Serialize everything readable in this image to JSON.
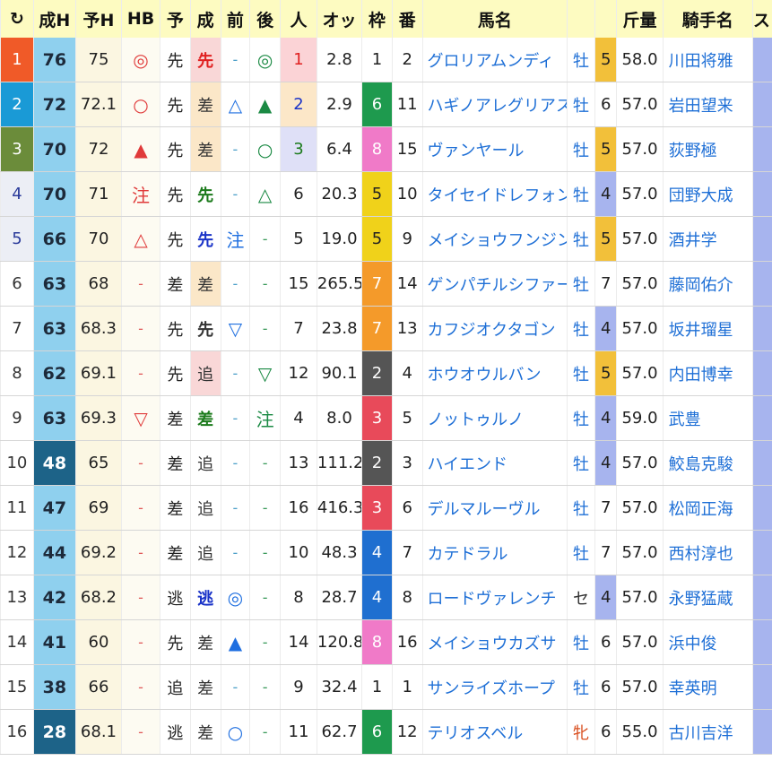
{
  "header": {
    "reload_icon": "↻",
    "columns": [
      "成H",
      "予H",
      "HB",
      "予",
      "成",
      "前",
      "後",
      "人",
      "オッ",
      "枠",
      "番",
      "馬名",
      "",
      "斤量",
      "騎手名",
      "ス"
    ]
  },
  "rows": [
    {
      "rank": "1",
      "seih": "76",
      "yoh": "75",
      "hb": "◎",
      "yo": "先",
      "sei": "先",
      "mae": "-",
      "ato": "◎",
      "ninki": "1",
      "odds": "2.8",
      "waku": "1",
      "ban": "2",
      "name": "グロリアムンディ",
      "sex": "牡",
      "age": "5",
      "kinryo": "58.0",
      "jockey": "川田将雅"
    },
    {
      "rank": "2",
      "seih": "72",
      "yoh": "72.1",
      "hb": "○",
      "yo": "先",
      "sei": "差",
      "mae": "△",
      "ato": "▲",
      "ninki": "2",
      "odds": "2.9",
      "waku": "6",
      "ban": "11",
      "name": "ハギノアレグリアス",
      "sex": "牡",
      "age": "6",
      "kinryo": "57.0",
      "jockey": "岩田望来"
    },
    {
      "rank": "3",
      "seih": "70",
      "yoh": "72",
      "hb": "▲",
      "yo": "先",
      "sei": "差",
      "mae": "-",
      "ato": "○",
      "ninki": "3",
      "odds": "6.4",
      "waku": "8",
      "ban": "15",
      "name": "ヴァンヤール",
      "sex": "牡",
      "age": "5",
      "kinryo": "57.0",
      "jockey": "荻野極"
    },
    {
      "rank": "4",
      "seih": "70",
      "yoh": "71",
      "hb": "注",
      "yo": "先",
      "sei": "先",
      "mae": "-",
      "ato": "△",
      "ninki": "6",
      "odds": "20.3",
      "waku": "5",
      "ban": "10",
      "name": "タイセイドレフォン",
      "sex": "牡",
      "age": "4",
      "kinryo": "57.0",
      "jockey": "団野大成"
    },
    {
      "rank": "5",
      "seih": "66",
      "yoh": "70",
      "hb": "△",
      "yo": "先",
      "sei": "先",
      "mae": "注",
      "ato": "-",
      "ninki": "5",
      "odds": "19.0",
      "waku": "5",
      "ban": "9",
      "name": "メイショウフンジン",
      "sex": "牡",
      "age": "5",
      "kinryo": "57.0",
      "jockey": "酒井学"
    },
    {
      "rank": "6",
      "seih": "63",
      "yoh": "68",
      "hb": "-",
      "yo": "差",
      "sei": "差",
      "mae": "-",
      "ato": "-",
      "ninki": "15",
      "odds": "265.5",
      "waku": "7",
      "ban": "14",
      "name": "ゲンパチルシファー",
      "sex": "牡",
      "age": "7",
      "kinryo": "57.0",
      "jockey": "藤岡佑介"
    },
    {
      "rank": "7",
      "seih": "63",
      "yoh": "68.3",
      "hb": "-",
      "yo": "先",
      "sei": "先",
      "mae": "▽",
      "ato": "-",
      "ninki": "7",
      "odds": "23.8",
      "waku": "7",
      "ban": "13",
      "name": "カフジオクタゴン",
      "sex": "牡",
      "age": "4",
      "kinryo": "57.0",
      "jockey": "坂井瑠星"
    },
    {
      "rank": "8",
      "seih": "62",
      "yoh": "69.1",
      "hb": "-",
      "yo": "先",
      "sei": "追",
      "mae": "-",
      "ato": "▽",
      "ninki": "12",
      "odds": "90.1",
      "waku": "2",
      "ban": "4",
      "name": "ホウオウルバン",
      "sex": "牡",
      "age": "5",
      "kinryo": "57.0",
      "jockey": "内田博幸"
    },
    {
      "rank": "9",
      "seih": "63",
      "yoh": "69.3",
      "hb": "▽",
      "yo": "差",
      "sei": "差",
      "mae": "-",
      "ato": "注",
      "ninki": "4",
      "odds": "8.0",
      "waku": "3",
      "ban": "5",
      "name": "ノットゥルノ",
      "sex": "牡",
      "age": "4",
      "kinryo": "59.0",
      "jockey": "武豊"
    },
    {
      "rank": "10",
      "seih": "48",
      "yoh": "65",
      "hb": "-",
      "yo": "差",
      "sei": "追",
      "mae": "-",
      "ato": "-",
      "ninki": "13",
      "odds": "111.2",
      "waku": "2",
      "ban": "3",
      "name": "ハイエンド",
      "sex": "牡",
      "age": "4",
      "kinryo": "57.0",
      "jockey": "鮫島克駿"
    },
    {
      "rank": "11",
      "seih": "47",
      "yoh": "69",
      "hb": "-",
      "yo": "差",
      "sei": "追",
      "mae": "-",
      "ato": "-",
      "ninki": "16",
      "odds": "416.3",
      "waku": "3",
      "ban": "6",
      "name": "デルマルーヴル",
      "sex": "牡",
      "age": "7",
      "kinryo": "57.0",
      "jockey": "松岡正海"
    },
    {
      "rank": "12",
      "seih": "44",
      "yoh": "69.2",
      "hb": "-",
      "yo": "差",
      "sei": "追",
      "mae": "-",
      "ato": "-",
      "ninki": "10",
      "odds": "48.3",
      "waku": "4",
      "ban": "7",
      "name": "カテドラル",
      "sex": "牡",
      "age": "7",
      "kinryo": "57.0",
      "jockey": "西村淳也"
    },
    {
      "rank": "13",
      "seih": "42",
      "yoh": "68.2",
      "hb": "-",
      "yo": "逃",
      "sei": "逃",
      "mae": "◎",
      "ato": "-",
      "ninki": "8",
      "odds": "28.7",
      "waku": "4",
      "ban": "8",
      "name": "ロードヴァレンチ",
      "sex": "セ",
      "age": "4",
      "kinryo": "57.0",
      "jockey": "永野猛蔵"
    },
    {
      "rank": "14",
      "seih": "41",
      "yoh": "60",
      "hb": "-",
      "yo": "先",
      "sei": "差",
      "mae": "▲",
      "ato": "-",
      "ninki": "14",
      "odds": "120.8",
      "waku": "8",
      "ban": "16",
      "name": "メイショウカズサ",
      "sex": "牡",
      "age": "6",
      "kinryo": "57.0",
      "jockey": "浜中俊"
    },
    {
      "rank": "15",
      "seih": "38",
      "yoh": "66",
      "hb": "-",
      "yo": "追",
      "sei": "差",
      "mae": "-",
      "ato": "-",
      "ninki": "9",
      "odds": "32.4",
      "waku": "1",
      "ban": "1",
      "name": "サンライズホープ",
      "sex": "牡",
      "age": "6",
      "kinryo": "57.0",
      "jockey": "幸英明"
    },
    {
      "rank": "16",
      "seih": "28",
      "yoh": "68.1",
      "hb": "-",
      "yo": "逃",
      "sei": "差",
      "mae": "○",
      "ato": "-",
      "ninki": "11",
      "odds": "62.7",
      "waku": "6",
      "ban": "12",
      "name": "テリオスベル",
      "sex": "牝",
      "age": "6",
      "kinryo": "55.0",
      "jockey": "古川吉洋"
    }
  ]
}
